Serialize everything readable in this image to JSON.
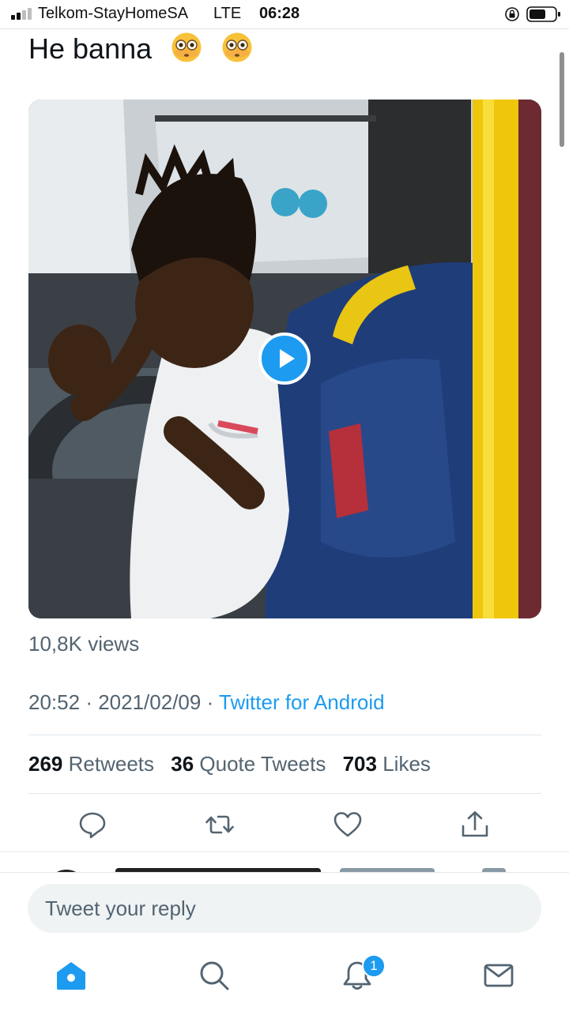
{
  "status_bar": {
    "carrier": "Telkom-StayHomeSA",
    "network": "LTE",
    "time": "06:28",
    "signal_bars": 4,
    "signal_bars_filled": 2
  },
  "tweet": {
    "text": "He banna",
    "emoji": [
      "flushed-face-emoji",
      "flushed-face-emoji"
    ],
    "views_count": "10,8K",
    "views_label": "views",
    "time": "20:52",
    "separator": "·",
    "date": "2021/02/09",
    "source": "Twitter for Android"
  },
  "stats": {
    "retweets_count": "269",
    "retweets_label": "Retweets",
    "quotes_count": "36",
    "quotes_label": "Quote Tweets",
    "likes_count": "703",
    "likes_label": "Likes"
  },
  "actions": [
    "reply-icon",
    "retweet-icon",
    "like-icon",
    "share-icon"
  ],
  "compose": {
    "placeholder": "Tweet your reply"
  },
  "tabs": [
    "home-icon",
    "search-icon",
    "notifications-icon",
    "messages-icon"
  ],
  "notification_badge": "1",
  "colors": {
    "accent": "#1d9bf0",
    "secondary_text": "#536471",
    "primary_text": "#0f1419",
    "input_bg": "#eff3f4"
  }
}
